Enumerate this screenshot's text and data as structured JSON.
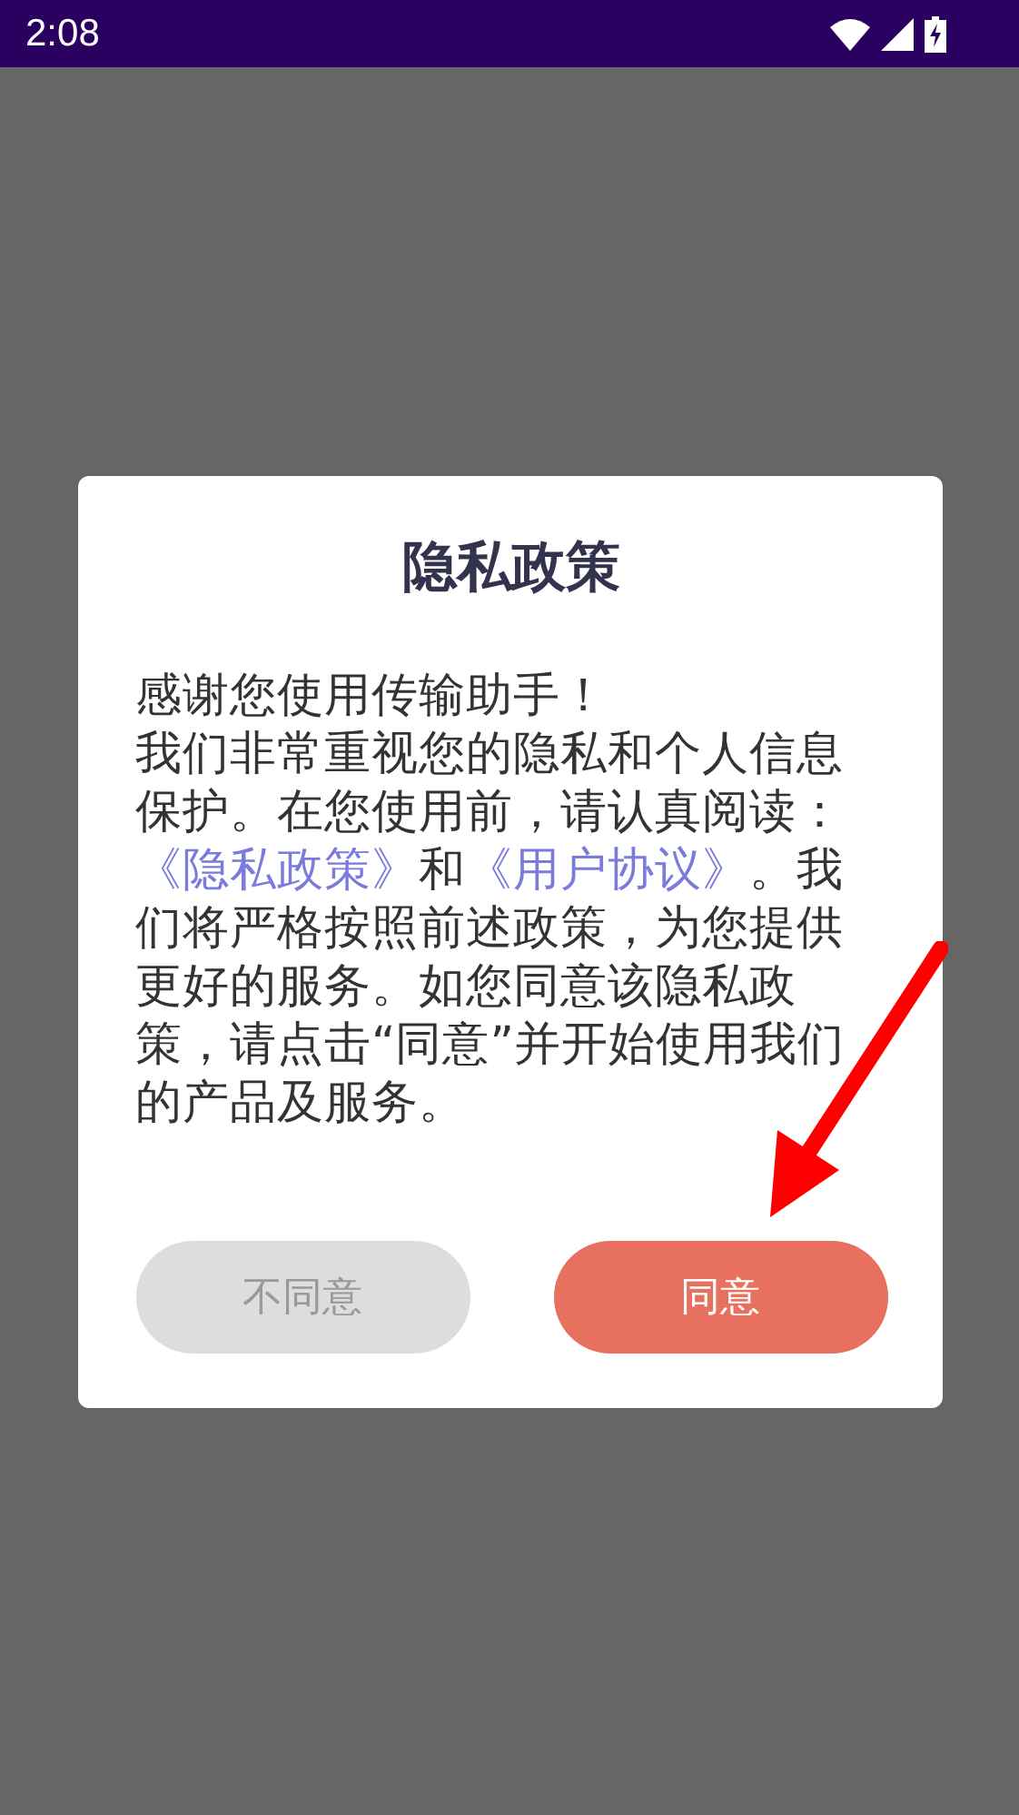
{
  "status_bar": {
    "time": "2:08"
  },
  "dialog": {
    "title": "隐私政策",
    "greeting": "感谢您使用传输助手！",
    "body": [
      {
        "kind": "text",
        "text": "我们非常重视您的隐私和个人信息保护。在您使用前，请认真阅读："
      },
      {
        "kind": "link",
        "text": "《隐私政策》"
      },
      {
        "kind": "text",
        "text": "和"
      },
      {
        "kind": "link",
        "text": "《用户协议》"
      },
      {
        "kind": "text",
        "text": "。我们将严格按照前述政策，为您提供更好的服务。如您同意该隐私政策，请点击“同意”并开始使用我们的产品及服务。"
      }
    ],
    "buttons": [
      {
        "kind": "secondary",
        "label": "不同意"
      },
      {
        "kind": "primary",
        "label": "同意"
      }
    ]
  }
}
